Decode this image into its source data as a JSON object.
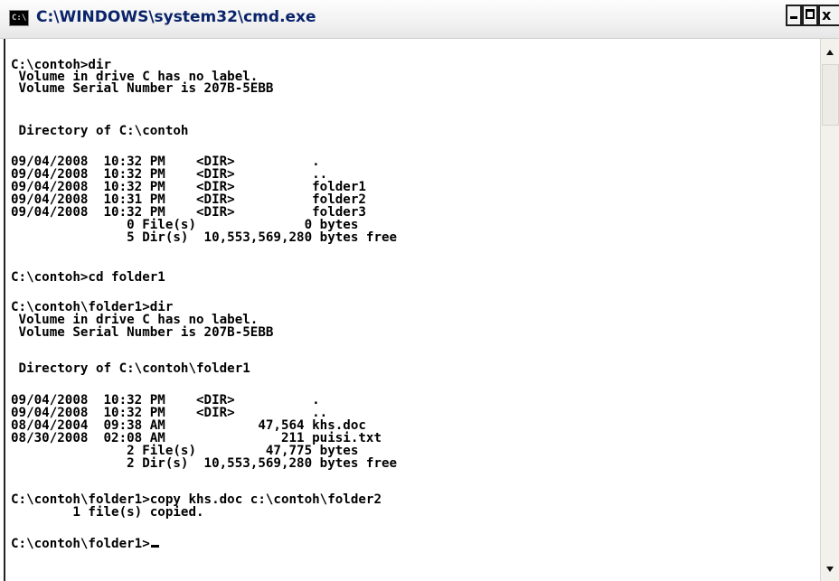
{
  "window": {
    "title": "C:\\WINDOWS\\system32\\cmd.exe",
    "icon": "cmd-window-icon",
    "icon_text": "C:\\",
    "buttons": {
      "minimize": "minimize-icon",
      "maximize": "maximize-icon",
      "close_label": "x"
    }
  },
  "console": {
    "lines": [
      "C:\\contoh>dir",
      " Volume in drive C has no label.",
      " Volume Serial Number is 207B-5EBB",
      "",
      " Directory of C:\\contoh",
      "",
      "09/04/2008  10:32 PM    <DIR>          .",
      "09/04/2008  10:32 PM    <DIR>          ..",
      "09/04/2008  10:32 PM    <DIR>          folder1",
      "09/04/2008  10:31 PM    <DIR>          folder2",
      "09/04/2008  10:32 PM    <DIR>          folder3",
      "               0 File(s)              0 bytes",
      "               5 Dir(s)  10,553,569,280 bytes free",
      "",
      "C:\\contoh>cd folder1",
      "",
      "C:\\contoh\\folder1>dir",
      " Volume in drive C has no label.",
      " Volume Serial Number is 207B-5EBB",
      "",
      " Directory of C:\\contoh\\folder1",
      "",
      "09/04/2008  10:32 PM    <DIR>          .",
      "09/04/2008  10:32 PM    <DIR>          ..",
      "08/04/2004  09:38 AM            47,564 khs.doc",
      "08/30/2008  02:08 AM               211 puisi.txt",
      "               2 File(s)         47,775 bytes",
      "               2 Dir(s)  10,553,569,280 bytes free",
      "",
      "C:\\contoh\\folder1>copy khs.doc c:\\contoh\\folder2",
      "        1 file(s) copied.",
      "",
      "C:\\contoh\\folder1>"
    ]
  },
  "scrollbar": {
    "up": "scroll-up-arrow-icon",
    "down": "scroll-down-arrow-icon"
  }
}
